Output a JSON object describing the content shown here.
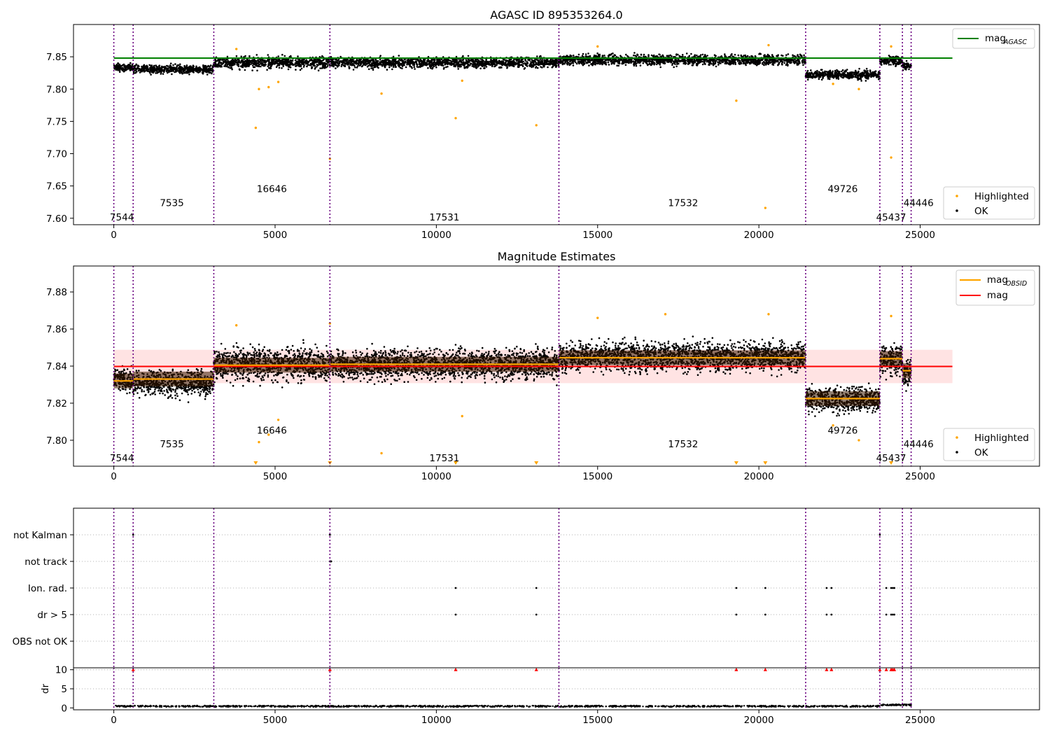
{
  "chart_data": [
    {
      "type": "scatter",
      "title": "AGASC ID 895353264.0",
      "xlim": [
        -1250,
        28700
      ],
      "ylim": [
        7.59,
        7.9
      ],
      "xticks": [
        0,
        5000,
        10000,
        15000,
        20000,
        25000
      ],
      "yticks": [
        7.6,
        7.65,
        7.7,
        7.75,
        7.8,
        7.85
      ],
      "ytick_labels": [
        "7.60",
        "7.65",
        "7.70",
        "7.75",
        "7.80",
        "7.85"
      ],
      "reference_line": {
        "label": "mag",
        "label_sub": "AGASC",
        "y": 7.848,
        "x_range": [
          0,
          26000
        ],
        "color": "#008000"
      },
      "legend": [
        "Highlighted",
        "OK"
      ],
      "segments": [
        {
          "x_start": 0,
          "x_end": 600,
          "median": 7.833,
          "spread": 0.006
        },
        {
          "x_start": 600,
          "x_end": 3100,
          "median": 7.831,
          "spread": 0.006
        },
        {
          "x_start": 3100,
          "x_end": 6700,
          "median": 7.841,
          "spread": 0.008
        },
        {
          "x_start": 6700,
          "x_end": 13800,
          "median": 7.841,
          "spread": 0.007
        },
        {
          "x_start": 13800,
          "x_end": 21450,
          "median": 7.845,
          "spread": 0.007
        },
        {
          "x_start": 21450,
          "x_end": 23750,
          "median": 7.822,
          "spread": 0.006
        },
        {
          "x_start": 23750,
          "x_end": 24450,
          "median": 7.844,
          "spread": 0.007
        },
        {
          "x_start": 24450,
          "x_end": 24720,
          "median": 7.836,
          "spread": 0.006
        }
      ],
      "highlighted_points": [
        [
          4400,
          7.74
        ],
        [
          4500,
          7.8
        ],
        [
          4800,
          7.803
        ],
        [
          5100,
          7.811
        ],
        [
          6700,
          7.692
        ],
        [
          8300,
          7.793
        ],
        [
          10600,
          7.755
        ],
        [
          10800,
          7.813
        ],
        [
          13100,
          7.744
        ],
        [
          19300,
          7.782
        ],
        [
          20200,
          7.616
        ],
        [
          22300,
          7.808
        ],
        [
          23100,
          7.8
        ],
        [
          24100,
          7.694
        ],
        [
          3800,
          7.862
        ],
        [
          15000,
          7.866
        ],
        [
          20300,
          7.868
        ],
        [
          24100,
          7.866
        ]
      ],
      "obsids": [
        {
          "label": "7544",
          "x": 250,
          "y": 7.602
        },
        {
          "label": "7535",
          "x": 1800,
          "y": 7.624
        },
        {
          "label": "16646",
          "x": 4900,
          "y": 7.646
        },
        {
          "label": "17531",
          "x": 10250,
          "y": 7.602
        },
        {
          "label": "17532",
          "x": 17650,
          "y": 7.624
        },
        {
          "label": "49726",
          "x": 22600,
          "y": 7.646
        },
        {
          "label": "45437",
          "x": 24100,
          "y": 7.602
        },
        {
          "label": "44446",
          "x": 24950,
          "y": 7.624
        }
      ]
    },
    {
      "type": "scatter",
      "title": "Magnitude Estimates",
      "xlim": [
        -1250,
        28700
      ],
      "ylim": [
        7.786,
        7.894
      ],
      "xticks": [
        0,
        5000,
        10000,
        15000,
        20000,
        25000
      ],
      "yticks": [
        7.8,
        7.82,
        7.84,
        7.86,
        7.88
      ],
      "ytick_labels": [
        "7.80",
        "7.82",
        "7.84",
        "7.86",
        "7.88"
      ],
      "mag_line": {
        "label": "mag",
        "y": 7.8398,
        "band": [
          7.8308,
          7.8488
        ],
        "x_range": [
          0,
          26000
        ],
        "color": "#ff0000"
      },
      "obsid_mag_label": "mag",
      "obsid_mag_sub": "OBSID",
      "obsid_mag": [
        {
          "x_start": 0,
          "x_end": 600,
          "y": 7.832
        },
        {
          "x_start": 600,
          "x_end": 3100,
          "y": 7.833
        },
        {
          "x_start": 3100,
          "x_end": 6700,
          "y": 7.8405
        },
        {
          "x_start": 6700,
          "x_end": 13800,
          "y": 7.841
        },
        {
          "x_start": 13800,
          "x_end": 21450,
          "y": 7.8445
        },
        {
          "x_start": 21450,
          "x_end": 23750,
          "y": 7.8225
        },
        {
          "x_start": 23750,
          "x_end": 24450,
          "y": 7.844
        },
        {
          "x_start": 24450,
          "x_end": 24720,
          "y": 7.8375
        }
      ],
      "segments": [
        {
          "x_start": 0,
          "x_end": 600,
          "median": 7.833,
          "spread": 0.006
        },
        {
          "x_start": 600,
          "x_end": 3100,
          "median": 7.831,
          "spread": 0.006
        },
        {
          "x_start": 3100,
          "x_end": 6700,
          "median": 7.841,
          "spread": 0.008
        },
        {
          "x_start": 6700,
          "x_end": 13800,
          "median": 7.841,
          "spread": 0.007
        },
        {
          "x_start": 13800,
          "x_end": 21450,
          "median": 7.845,
          "spread": 0.007
        },
        {
          "x_start": 21450,
          "x_end": 23750,
          "median": 7.822,
          "spread": 0.006
        },
        {
          "x_start": 23750,
          "x_end": 24450,
          "median": 7.844,
          "spread": 0.007
        },
        {
          "x_start": 24450,
          "x_end": 24720,
          "median": 7.836,
          "spread": 0.006
        }
      ],
      "highlighted_points": [
        [
          4500,
          7.799
        ],
        [
          4800,
          7.803
        ],
        [
          5100,
          7.811
        ],
        [
          8300,
          7.793
        ],
        [
          10800,
          7.813
        ],
        [
          22300,
          7.808
        ],
        [
          23100,
          7.8
        ],
        [
          3800,
          7.862
        ],
        [
          15000,
          7.866
        ],
        [
          17100,
          7.868
        ],
        [
          20300,
          7.868
        ],
        [
          24100,
          7.867
        ],
        [
          6700,
          7.863
        ]
      ],
      "offscale_markers": [
        4400,
        6700,
        10600,
        13100,
        19300,
        20200,
        24100
      ],
      "legend": [
        "mag",
        "mag",
        "Highlighted",
        "OK"
      ],
      "obsids": [
        {
          "label": "7544",
          "x": 250,
          "y": 7.7905
        },
        {
          "label": "7535",
          "x": 1800,
          "y": 7.798
        },
        {
          "label": "16646",
          "x": 4900,
          "y": 7.8055
        },
        {
          "label": "17531",
          "x": 10250,
          "y": 7.7905
        },
        {
          "label": "17532",
          "x": 17650,
          "y": 7.798
        },
        {
          "label": "49726",
          "x": 22600,
          "y": 7.8055
        },
        {
          "label": "45437",
          "x": 24100,
          "y": 7.7905
        },
        {
          "label": "44446",
          "x": 24950,
          "y": 7.798
        }
      ]
    },
    {
      "type": "scatter",
      "title": "",
      "xlim": [
        -1250,
        28700
      ],
      "categories": [
        "not Kalman",
        "not track",
        "Ion. rad.",
        "dr > 5",
        "OBS not OK"
      ],
      "flags": {
        "not Kalman": [
          600,
          6700,
          23750
        ],
        "not track": [
          6700,
          6720,
          6740
        ],
        "Ion. rad.": [
          10600,
          13100,
          19300,
          20200,
          22100,
          22250,
          23950,
          24100,
          24150,
          24200
        ],
        "dr > 5": [
          10600,
          13100,
          19300,
          20200,
          22100,
          22250,
          23950,
          24100,
          24150,
          24200
        ],
        "OBS not OK": []
      }
    },
    {
      "type": "scatter",
      "title": "",
      "ylabel": "dr",
      "xlim": [
        -1250,
        28700
      ],
      "ylim": [
        -0.5,
        10.5
      ],
      "yticks": [
        0,
        5,
        10
      ],
      "xticks": [
        0,
        5000,
        10000,
        15000,
        20000,
        25000
      ],
      "clipped_markers": [
        600,
        6700,
        10600,
        13100,
        19300,
        20200,
        22100,
        22250,
        23750,
        23950,
        24100,
        24150,
        24200
      ]
    }
  ],
  "obsid_boundaries": [
    0,
    600,
    3100,
    6700,
    13800,
    21450,
    23750,
    24450,
    24720
  ],
  "colors": {
    "ok": "#000000",
    "highlighted": "#ffa500",
    "agasc": "#008000",
    "mag": "#ff0000",
    "band": "#ffc0c0",
    "obsid_line": "#6a0080",
    "flag": "#ff0000"
  }
}
